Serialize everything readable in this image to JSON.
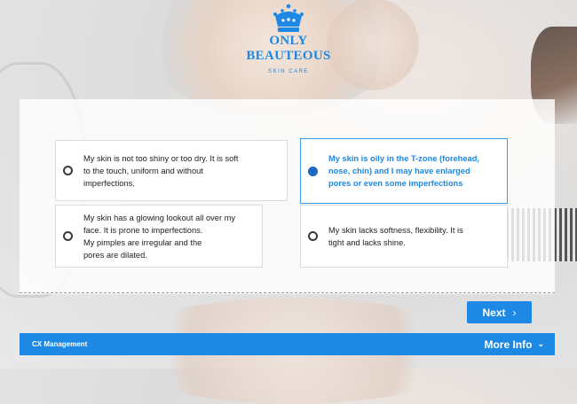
{
  "brand": {
    "line1": "ONLY",
    "line2": "BEAUTEOUS",
    "tagline": "SKIN CARE",
    "color": "#1e88e5"
  },
  "options": [
    {
      "lines": [
        "My skin is not too shiny or too dry. It is soft",
        "to the touch, uniform and without",
        "imperfections."
      ],
      "selected": false
    },
    {
      "lines": [
        "My skin is oily in the T-zone (forehead,",
        "nose, chin) and I may have enlarged",
        "pores or even some imperfections"
      ],
      "selected": true
    },
    {
      "lines": [
        "My skin has a glowing lookout all over my",
        "face. It is prone to imperfections.",
        "My pimples are irregular and the",
        "pores are dilated."
      ],
      "selected": false
    },
    {
      "lines": [
        "My skin lacks softness, flexibility. It is",
        "tight and lacks shine."
      ],
      "selected": false
    }
  ],
  "next_button": {
    "label": "Next",
    "icon": "chevron-right-icon"
  },
  "footer": {
    "left_text": "CX Management",
    "right_label": "More Info",
    "right_icon": "chevron-down-icon"
  }
}
